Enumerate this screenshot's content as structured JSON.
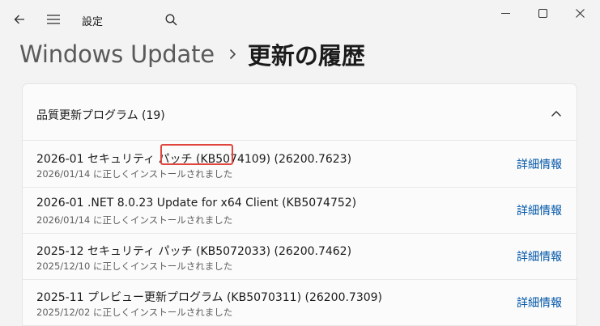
{
  "app": {
    "title": "設定"
  },
  "breadcrumb": {
    "parent": "Windows Update",
    "current": "更新の履歴"
  },
  "section": {
    "title": "品質更新プログラム (19)",
    "items": [
      {
        "title": "2026-01 セキュリティ パッチ (KB5074109) (26200.7623)",
        "subtitle": "2026/01/14 に正しくインストールされました",
        "link": "詳細情報"
      },
      {
        "title": "2026-01 .NET 8.0.23 Update for x64 Client (KB5074752)",
        "subtitle": "2026/01/14 に正しくインストールされました",
        "link": "詳細情報"
      },
      {
        "title": "2025-12 セキュリティ パッチ (KB5072033) (26200.7462)",
        "subtitle": "2025/12/10 に正しくインストールされました",
        "link": "詳細情報"
      },
      {
        "title": "2025-11 プレビュー更新プログラム (KB5070311) (26200.7309)",
        "subtitle": "2025/12/02 に正しくインストールされました",
        "link": "詳細情報"
      }
    ]
  },
  "icons": {
    "back": "back-arrow-icon",
    "menu": "hamburger-menu-icon",
    "search": "search-icon",
    "minimize": "minimize-icon",
    "maximize": "maximize-icon",
    "close": "close-icon",
    "chevron_right": "chevron-right-icon",
    "chevron_up": "chevron-up-icon"
  },
  "colors": {
    "link": "#0055a8",
    "highlight": "#e0463e",
    "background": "#f3f3f3",
    "card": "#fbfbfb"
  }
}
